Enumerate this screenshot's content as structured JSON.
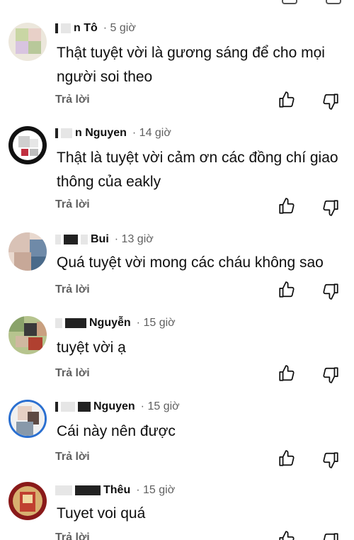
{
  "comments": [
    {
      "author": "n Tô",
      "time": "· 5 giờ",
      "text": "Thật tuyệt vời là gương sáng để cho mọi người soi theo",
      "reply_label": "Trả lời",
      "like_icon": "thumbs-up-icon",
      "dislike_icon": "thumbs-down-icon",
      "avatar_colors": [
        "#c9d6a4",
        "#e8d0c8",
        "#d8c4e0",
        "#b8c89a",
        "#f0e6d2"
      ]
    },
    {
      "author": "n Nguyen",
      "time": "· 14 giờ",
      "text": "Thật là tuyệt vời  cảm ơn  các đồng chí giao thông của eakly",
      "reply_label": "Trả lời",
      "like_icon": "thumbs-up-icon",
      "dislike_icon": "thumbs-down-icon",
      "avatar_colors": [
        "#111111",
        "#e8e8e8",
        "#c03040",
        "#444444",
        "#f4f4f4"
      ]
    },
    {
      "author": "Bui",
      "time": "· 13 giờ",
      "text": "Quá tuyệt vời mong các cháu không sao",
      "reply_label": "Trả lời",
      "like_icon": "thumbs-up-icon",
      "dislike_icon": "thumbs-down-icon",
      "avatar_colors": [
        "#d9c2b6",
        "#6f8aa8",
        "#e9d9cf",
        "#4a6a8a",
        "#c7a898"
      ]
    },
    {
      "author": "Nguyễn",
      "time": "· 15 giờ",
      "text": "tuyệt vời ạ",
      "reply_label": "Trả lời",
      "like_icon": "thumbs-up-icon",
      "dislike_icon": "thumbs-down-icon",
      "avatar_colors": [
        "#8aa36a",
        "#c9a080",
        "#3a3a3a",
        "#d0b8a0",
        "#b04030"
      ]
    },
    {
      "author": "Nguyen",
      "time": "· 15 giờ",
      "text": "Cái này nên được",
      "reply_label": "Trả lời",
      "like_icon": "thumbs-up-icon",
      "dislike_icon": "thumbs-down-icon",
      "avatar_colors": [
        "#2a6fd0",
        "#e6d0c4",
        "#8899aa",
        "#5d4a44",
        "#f0f0f0"
      ]
    },
    {
      "author": "Thêu",
      "time": "· 15 giờ",
      "text": "Tuyet voi quá",
      "reply_label": "Trả lời",
      "like_icon": "thumbs-up-icon",
      "dislike_icon": "thumbs-down-icon",
      "avatar_colors": [
        "#8a1a1a",
        "#d8b070",
        "#c04030",
        "#f0d8a0",
        "#6a2010"
      ]
    }
  ]
}
